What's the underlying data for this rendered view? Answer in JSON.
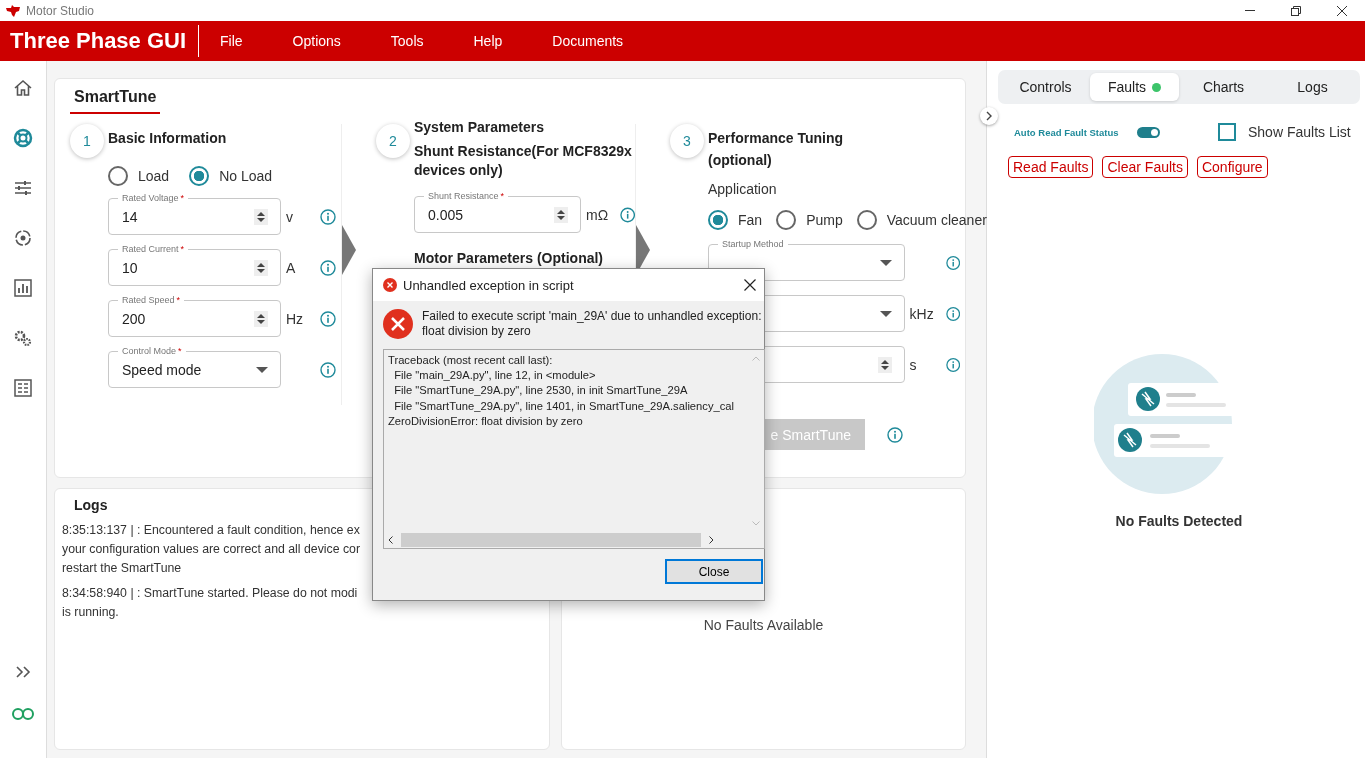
{
  "window": {
    "title": "Motor Studio"
  },
  "header": {
    "brand": "Three Phase GUI",
    "menu": [
      "File",
      "Options",
      "Tools",
      "Help",
      "Documents"
    ]
  },
  "sidebar": {
    "items": [
      {
        "selected": false
      },
      {
        "selected": true
      },
      {
        "selected": false
      },
      {
        "selected": false
      },
      {
        "selected": false
      },
      {
        "selected": false
      },
      {
        "selected": false
      }
    ]
  },
  "smarttune": {
    "tab": "SmartTune",
    "steps": [
      {
        "number": "1",
        "title": "Basic Information",
        "radios": [
          {
            "label": "Load",
            "selected": false
          },
          {
            "label": "No Load",
            "selected": true
          }
        ],
        "fields": [
          {
            "kind": "spinner",
            "label": "Rated Voltage",
            "required": "*",
            "value": "14",
            "unit": "v"
          },
          {
            "kind": "spinner",
            "label": "Rated Current",
            "required": "*",
            "value": "10",
            "unit": "A"
          },
          {
            "kind": "spinner",
            "label": "Rated Speed",
            "required": "*",
            "value": "200",
            "unit": "Hz"
          },
          {
            "kind": "select",
            "label": "Control Mode",
            "required": "*",
            "value": "Speed mode"
          }
        ]
      },
      {
        "number": "2",
        "title": "System Parameters",
        "subtitle": "Shunt Resistance(For MCF8329x devices only)",
        "fields": [
          {
            "kind": "spinner",
            "label": "Shunt Resistance",
            "required": "*",
            "value": "0.005",
            "unit": "mΩ"
          }
        ],
        "section": "Motor Parameters (Optional)"
      },
      {
        "number": "3",
        "title": "Performance Tuning (optional)",
        "group_label": "Application",
        "radios": [
          {
            "label": "Fan",
            "selected": true
          },
          {
            "label": "Pump",
            "selected": false
          },
          {
            "label": "Vacuum cleaner",
            "selected": false
          }
        ],
        "fields": [
          {
            "kind": "select",
            "label": "Startup Method"
          },
          {
            "kind": "select",
            "unit": "kHz"
          },
          {
            "kind": "spinner",
            "unit": "s"
          }
        ],
        "button": "e SmartTune"
      }
    ]
  },
  "logs": {
    "title": "Logs",
    "entries": [
      {
        "lines": [
          "8:35:13:137 | : Encountered a fault condition, hence ex",
          "your configuration values are correct and all device cor",
          "restart the SmartTune"
        ]
      },
      {
        "lines": [
          "8:34:58:940 | : SmartTune started. Please do not modi",
          "is running."
        ]
      }
    ]
  },
  "faults_panel": {
    "empty_text": "No Faults Available"
  },
  "right_panel": {
    "tabs": [
      {
        "label": "Controls",
        "selected": false
      },
      {
        "label": "Faults",
        "selected": true,
        "color": "#3cc46a"
      },
      {
        "label": "Charts",
        "selected": false
      },
      {
        "label": "Logs",
        "selected": false
      }
    ],
    "auto_read": {
      "label": "Auto Read Fault Status",
      "on": true
    },
    "show_list": {
      "label": "Show Faults List",
      "checked": false
    },
    "buttons": [
      "Read Faults",
      "Clear Faults",
      "Configure"
    ],
    "empty_text": "No Faults Detected"
  },
  "dialog": {
    "title": "Unhandled exception in script",
    "message": "Failed to execute script 'main_29A' due to unhandled exception:\nfloat division by zero",
    "traceback": [
      "Traceback (most recent call last):",
      "  File \"main_29A.py\", line 12, in <module>",
      "  File \"SmartTune_29A.py\", line 2530, in init SmartTune_29A",
      "  File \"SmartTune_29A.py\", line 1401, in SmartTune_29A.saliency_cal",
      "ZeroDivisionError: float division by zero"
    ],
    "button": "Close"
  }
}
